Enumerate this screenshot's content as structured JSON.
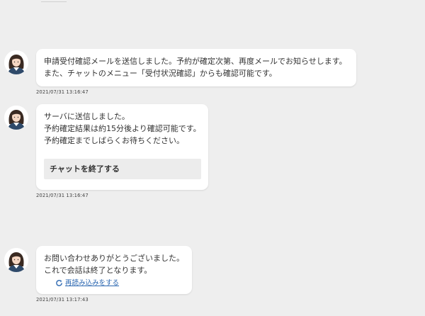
{
  "messages": [
    {
      "lines": [
        "申請受付確認メールを送信しました。予約が確定次第、再度メールでお知らせします。",
        "また、チャットのメニュー「受付状況確認」からも確認可能です。"
      ],
      "timestamp": "2021/07/31 13:16:47"
    },
    {
      "lines": [
        "サーバに送信しました。",
        "予約確定結果は約15分後より確認可能です。",
        "予約確定までしばらくお待ちください。"
      ],
      "button_label": "チャットを終了する",
      "timestamp": "2021/07/31 13:16:47"
    },
    {
      "lines": [
        "お問い合わせありがとうございました。",
        "これで会話は終了となります。"
      ],
      "link_label": "再読み込みをする",
      "timestamp": "2021/07/31 13:17:43"
    }
  ],
  "colors": {
    "background": "#eeeeee",
    "bubble": "#ffffff",
    "link": "#2a66b0",
    "button": "#ececec"
  },
  "icons": {
    "avatar": "operator-avatar-icon",
    "reload": "refresh-icon"
  }
}
